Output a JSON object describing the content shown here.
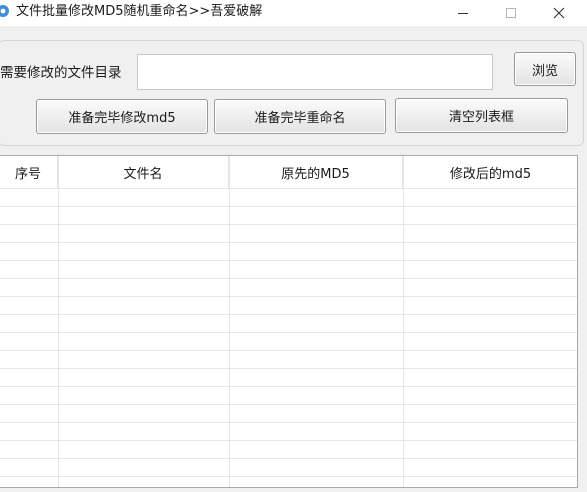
{
  "window": {
    "title": "文件批量修改MD5随机重命名>>吾爱破解"
  },
  "icons": {
    "app": "gear-icon",
    "minimize": "minimize-icon",
    "maximize": "maximize-icon",
    "close": "close-icon"
  },
  "form": {
    "dir_label": "需要修改的文件目录",
    "dir_value": "",
    "browse_label": "浏览"
  },
  "actions": {
    "md5_label": "准备完毕修改md5",
    "rename_label": "准备完毕重命名",
    "clear_label": "清空列表框"
  },
  "table": {
    "columns": [
      "序号",
      "文件名",
      "原先的MD5",
      "修改后的md5"
    ],
    "rows": []
  },
  "colors": {
    "window_bg": "#f0f0f0",
    "titlebar_bg": "#ffffff",
    "grid_bg": "#ffffff",
    "grid_line": "#e3e3e3",
    "app_icon": "#3d8fd8"
  }
}
